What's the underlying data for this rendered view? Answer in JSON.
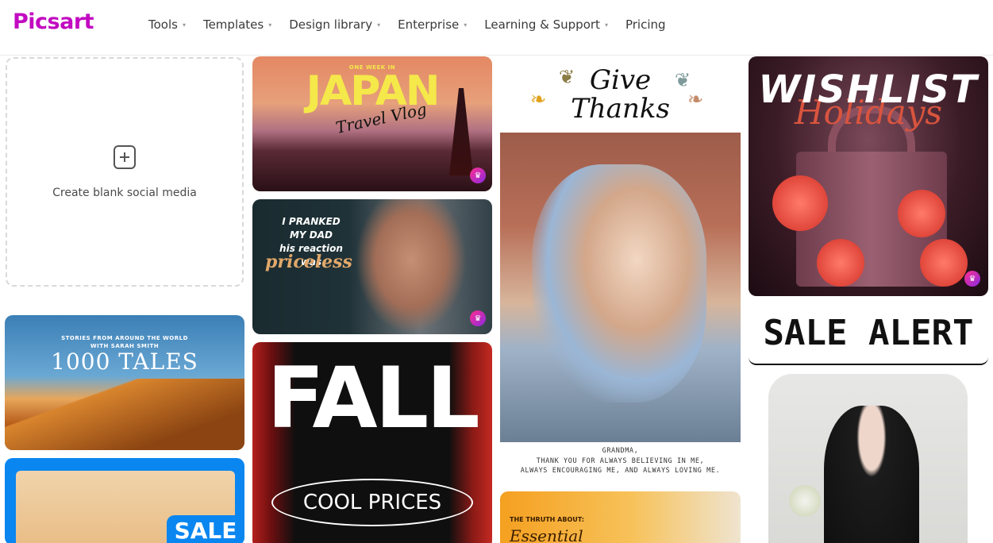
{
  "brand": {
    "logo_text": "Picsart",
    "accent": "#c209c1"
  },
  "nav": {
    "items": [
      {
        "label": "Tools",
        "has_dropdown": true
      },
      {
        "label": "Templates",
        "has_dropdown": true
      },
      {
        "label": "Design library",
        "has_dropdown": true
      },
      {
        "label": "Enterprise",
        "has_dropdown": true
      },
      {
        "label": "Learning & Support",
        "has_dropdown": true
      },
      {
        "label": "Pricing",
        "has_dropdown": false
      }
    ]
  },
  "blank_card": {
    "label": "Create blank social media",
    "icon": "plus-square-icon"
  },
  "templates": {
    "tales": {
      "small_line1": "STORIES FROM AROUND THE WORLD",
      "small_line2": "WITH SARAH SMITH",
      "title": "1000 TALES"
    },
    "sale": {
      "label": "SALE"
    },
    "japan": {
      "kicker": "ONE WEEK IN",
      "title": "JAPAN",
      "subtitle": "Travel Vlog",
      "premium": true
    },
    "prank": {
      "line1": "I PRANKED",
      "line2": "MY DAD",
      "line3": "his reaction was",
      "line4": "priceless",
      "premium": true
    },
    "fall": {
      "title": "FALL",
      "pill": "COOL PRICES"
    },
    "thanks": {
      "head1": "Give",
      "head2": "Thanks",
      "caption1": "GRANDMA,",
      "caption2": "THANK YOU FOR ALWAYS BELIEVING IN ME,",
      "caption3": "ALWAYS ENCOURAGING ME, AND ALWAYS LOVING ME."
    },
    "truth": {
      "kicker": "THE THRUTH ABOUT:",
      "title": "Essential"
    },
    "wishlist": {
      "title": "WISHLIST",
      "script": "Holidays",
      "premium": true
    },
    "sale_alert": {
      "title": "SALE ALERT"
    }
  },
  "icons": {
    "caret": "▾",
    "premium": "♛"
  }
}
